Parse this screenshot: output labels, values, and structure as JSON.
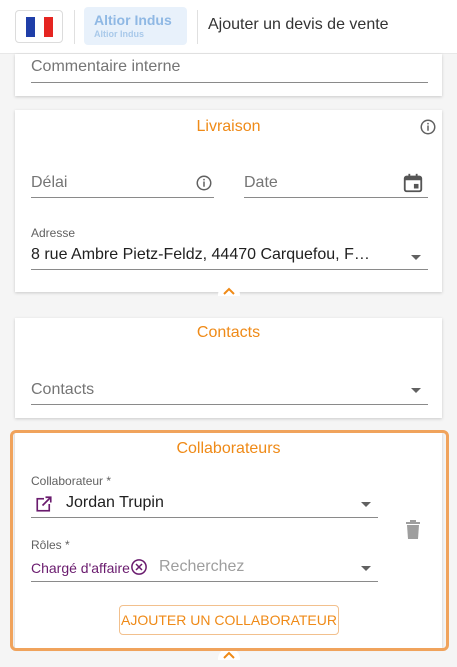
{
  "header": {
    "company_name": "Altior Indus",
    "company_subname": "Altior Indus",
    "page_title": "Ajouter un devis de vente",
    "flag_colors": [
      "#1f3ea8",
      "#ffffff",
      "#e52521"
    ]
  },
  "comment_card": {
    "placeholder": "Commentaire interne"
  },
  "livraison": {
    "title": "Livraison",
    "delai_placeholder": "Délai",
    "date_placeholder": "Date",
    "adresse_label": "Adresse",
    "adresse_value": "8 rue Ambre Pietz-Feldz, 44470 Carquefou, F…"
  },
  "contacts": {
    "title": "Contacts",
    "placeholder": "Contacts"
  },
  "collaborateurs": {
    "title": "Collaborateurs",
    "collaborateur_label": "Collaborateur *",
    "collaborateur_value": "Jordan Trupin",
    "roles_label": "Rôles *",
    "role_chip": "Chargé d'affaire",
    "search_placeholder": "Recherchez",
    "add_button": "AJOUTER UN COLLABORATEUR"
  },
  "colors": {
    "accent": "#ef8a17",
    "highlight_border": "#f0a35c",
    "chip_text": "#6a1b6e"
  }
}
